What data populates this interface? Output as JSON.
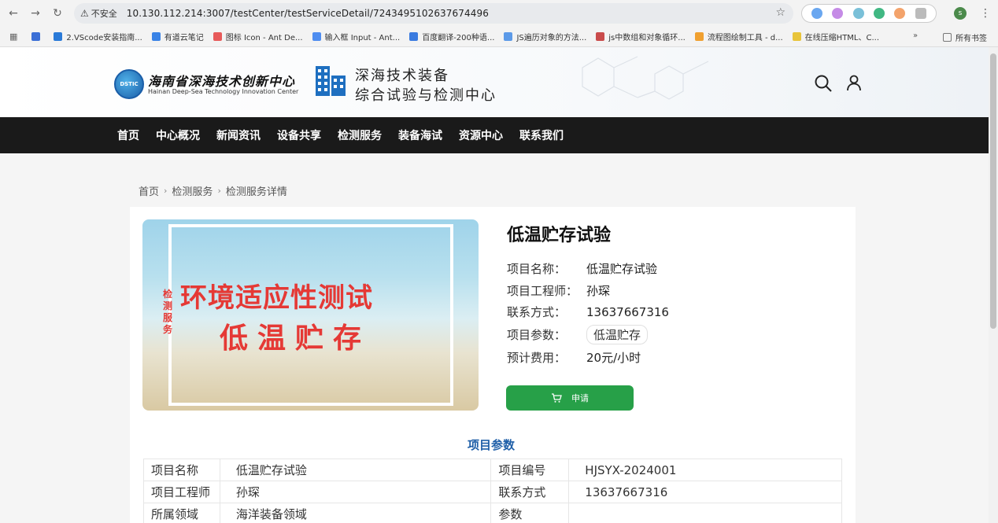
{
  "browser": {
    "insecure_label": "不安全",
    "url": "10.130.112.214:3007/testCenter/testServiceDetail/7243495102637674496",
    "profile_initial": "s",
    "bookmarks": [
      "2.VScode安装指南...",
      "有道云笔记",
      "图标 Icon - Ant De...",
      "输入框 Input - Ant...",
      "百度翻译-200种语...",
      "JS遍历对象的方法...",
      "js中数组和对象循环...",
      "流程图绘制工具 - d...",
      "在线压缩HTML、C..."
    ],
    "bookmarks_more": "»",
    "all_bookmarks": "所有书签"
  },
  "header": {
    "logo_badge": "DSTIC",
    "logo_cn": "海南省深海技术创新中心",
    "logo_en": "Hainan Deep-Sea Technology Innovation Center",
    "title_line1": "深海技术装备",
    "title_line2": "综合试验与检测中心"
  },
  "nav": [
    "首页",
    "中心概况",
    "新闻资讯",
    "设备共享",
    "检测服务",
    "装备海试",
    "资源中心",
    "联系我们"
  ],
  "breadcrumb": [
    "首页",
    "检测服务",
    "检测服务详情"
  ],
  "hero": {
    "side_text": "检测服务",
    "line1": "环境适应性测试",
    "line2": "低温贮存"
  },
  "service": {
    "title": "低温贮存试验",
    "rows": [
      {
        "label": "项目名称：",
        "value": "低温贮存试验"
      },
      {
        "label": "项目工程师：",
        "value": "孙琛"
      },
      {
        "label": "联系方式：",
        "value": "13637667316"
      },
      {
        "label": "项目参数：",
        "value": "低温贮存"
      },
      {
        "label": "预计费用：",
        "value": "20元/小时"
      }
    ],
    "apply_label": "申请"
  },
  "params": {
    "section_title": "项目参数",
    "rows": [
      [
        "项目名称",
        "低温贮存试验",
        "项目编号",
        "HJSYX-2024001"
      ],
      [
        "项目工程师",
        "孙琛",
        "联系方式",
        "13637667316"
      ],
      [
        "所属领域",
        "海洋装备领域",
        "参数",
        ""
      ]
    ]
  },
  "colors": {
    "nav_bg": "#1a1a1a",
    "accent_green": "#27a048",
    "hero_red": "#e53935",
    "section_blue": "#1f5fa8"
  }
}
